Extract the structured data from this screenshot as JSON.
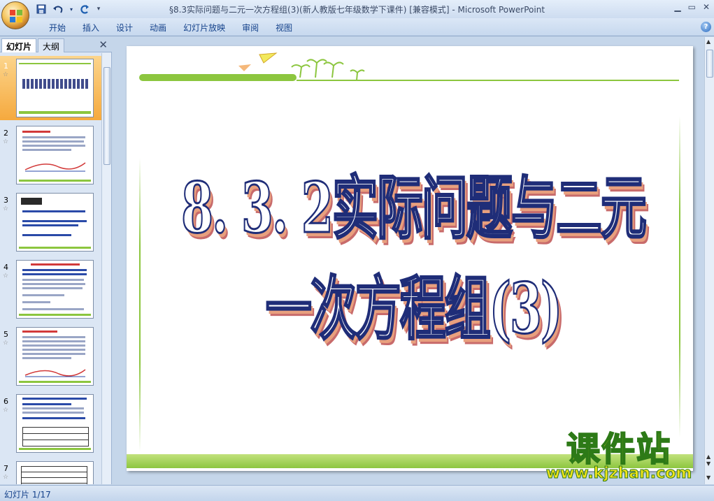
{
  "window": {
    "title": "§8.3实际问题与二元一次方程组(3)(新人教版七年级数学下课件) [兼容模式] - Microsoft PowerPoint"
  },
  "ribbon": {
    "tabs": [
      "开始",
      "插入",
      "设计",
      "动画",
      "幻灯片放映",
      "审阅",
      "视图"
    ]
  },
  "left_panel": {
    "tabs": {
      "slides": "幻灯片",
      "outline": "大纲"
    },
    "slides": [
      {
        "number": "1",
        "selected": true
      },
      {
        "number": "2",
        "selected": false
      },
      {
        "number": "3",
        "selected": false
      },
      {
        "number": "4",
        "selected": false
      },
      {
        "number": "5",
        "selected": false
      },
      {
        "number": "6",
        "selected": false
      },
      {
        "number": "7",
        "selected": false
      }
    ]
  },
  "slide": {
    "title": "8. 3. 2实际问题与二元一次方程组(3)"
  },
  "watermark": {
    "main": "课件站",
    "url": "www.kjzhan.com"
  },
  "status": {
    "slide_counter": "幻灯片 1/17"
  },
  "colors": {
    "accent_green": "#8cc63f",
    "title_outline": "#1f2d78",
    "selected_slide": "#f5a93e"
  }
}
